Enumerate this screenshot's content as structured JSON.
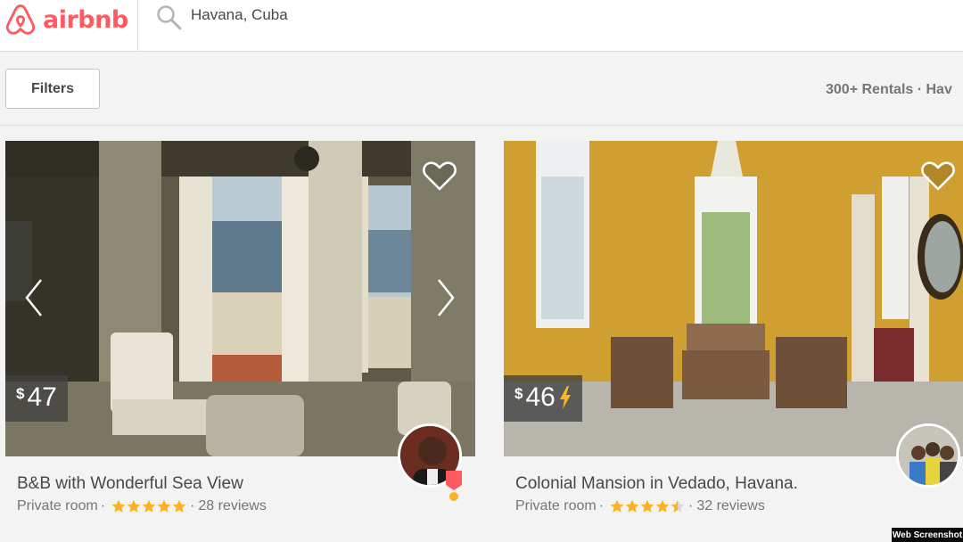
{
  "brand": {
    "name": "airbnb",
    "color": "#ff5a5f"
  },
  "search": {
    "value": "Havana, Cuba",
    "icon": "search-icon"
  },
  "filters": {
    "button_label": "Filters",
    "results_text": "300+ Rentals · Hav"
  },
  "listings": [
    {
      "title": "B&B with Wonderful Sea View",
      "currency": "$",
      "price": "47",
      "instant_book": false,
      "room_type": "Private room",
      "separator": "·",
      "rating": 5,
      "reviews": "28 reviews",
      "superhost": true
    },
    {
      "title": "Colonial Mansion in Vedado, Havana.",
      "currency": "$",
      "price": "46",
      "instant_book": true,
      "room_type": "Private room",
      "separator": "·",
      "rating": 4.5,
      "reviews": "32 reviews",
      "superhost": false
    }
  ],
  "colors": {
    "star": "#fcb322",
    "bolt": "#fcb322",
    "price_bg": "#404040"
  },
  "watermark": "Web Screenshot"
}
